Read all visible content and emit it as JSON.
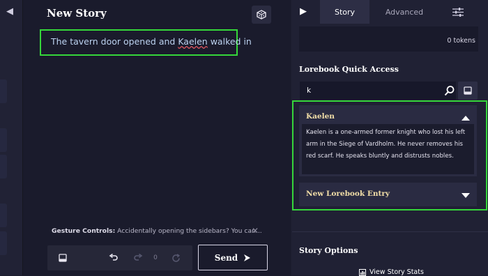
{
  "editor": {
    "title": "New Story",
    "story_text_before": "The tavern door opened and ",
    "story_text_flagged": "Kaelen",
    "story_text_after": " walked in"
  },
  "gesture_tip": {
    "label": "Gesture Controls:",
    "text": " Accidentally opening the sidebars? You can..."
  },
  "controls": {
    "retry_count": "0",
    "send_label": "Send"
  },
  "right_panel": {
    "tabs": [
      "Story",
      "Advanced"
    ],
    "active_tab": "Story",
    "token_count": "0 tokens",
    "lorebook": {
      "heading": "Lorebook Quick Access",
      "search_value": "k",
      "entries": [
        {
          "title": "Kaelen",
          "expanded": true,
          "description": "Kaelen is a one-armed former knight who lost his left arm in the Siege of Vardholm. He never removes his red scarf. He speaks bluntly and distrusts nobles."
        },
        {
          "title": "New Lorebook Entry",
          "expanded": false
        }
      ]
    },
    "story_options_heading": "Story Options",
    "view_stats_label": "View Story Stats"
  },
  "colors": {
    "background": "#1c1d2e",
    "panel": "#202134",
    "highlight_box": "#35d63a",
    "entry_title": "#f3dfa8",
    "story_text": "#bcd2f0"
  },
  "icons": [
    "chevron-left-icon",
    "dice-icon",
    "book-icon",
    "undo-icon",
    "redo-icon",
    "refresh-icon",
    "send-arrow-icon",
    "chevron-right-icon",
    "sliders-icon",
    "search-icon",
    "chevron-up-icon",
    "chevron-down-icon",
    "close-icon",
    "stats-icon"
  ]
}
